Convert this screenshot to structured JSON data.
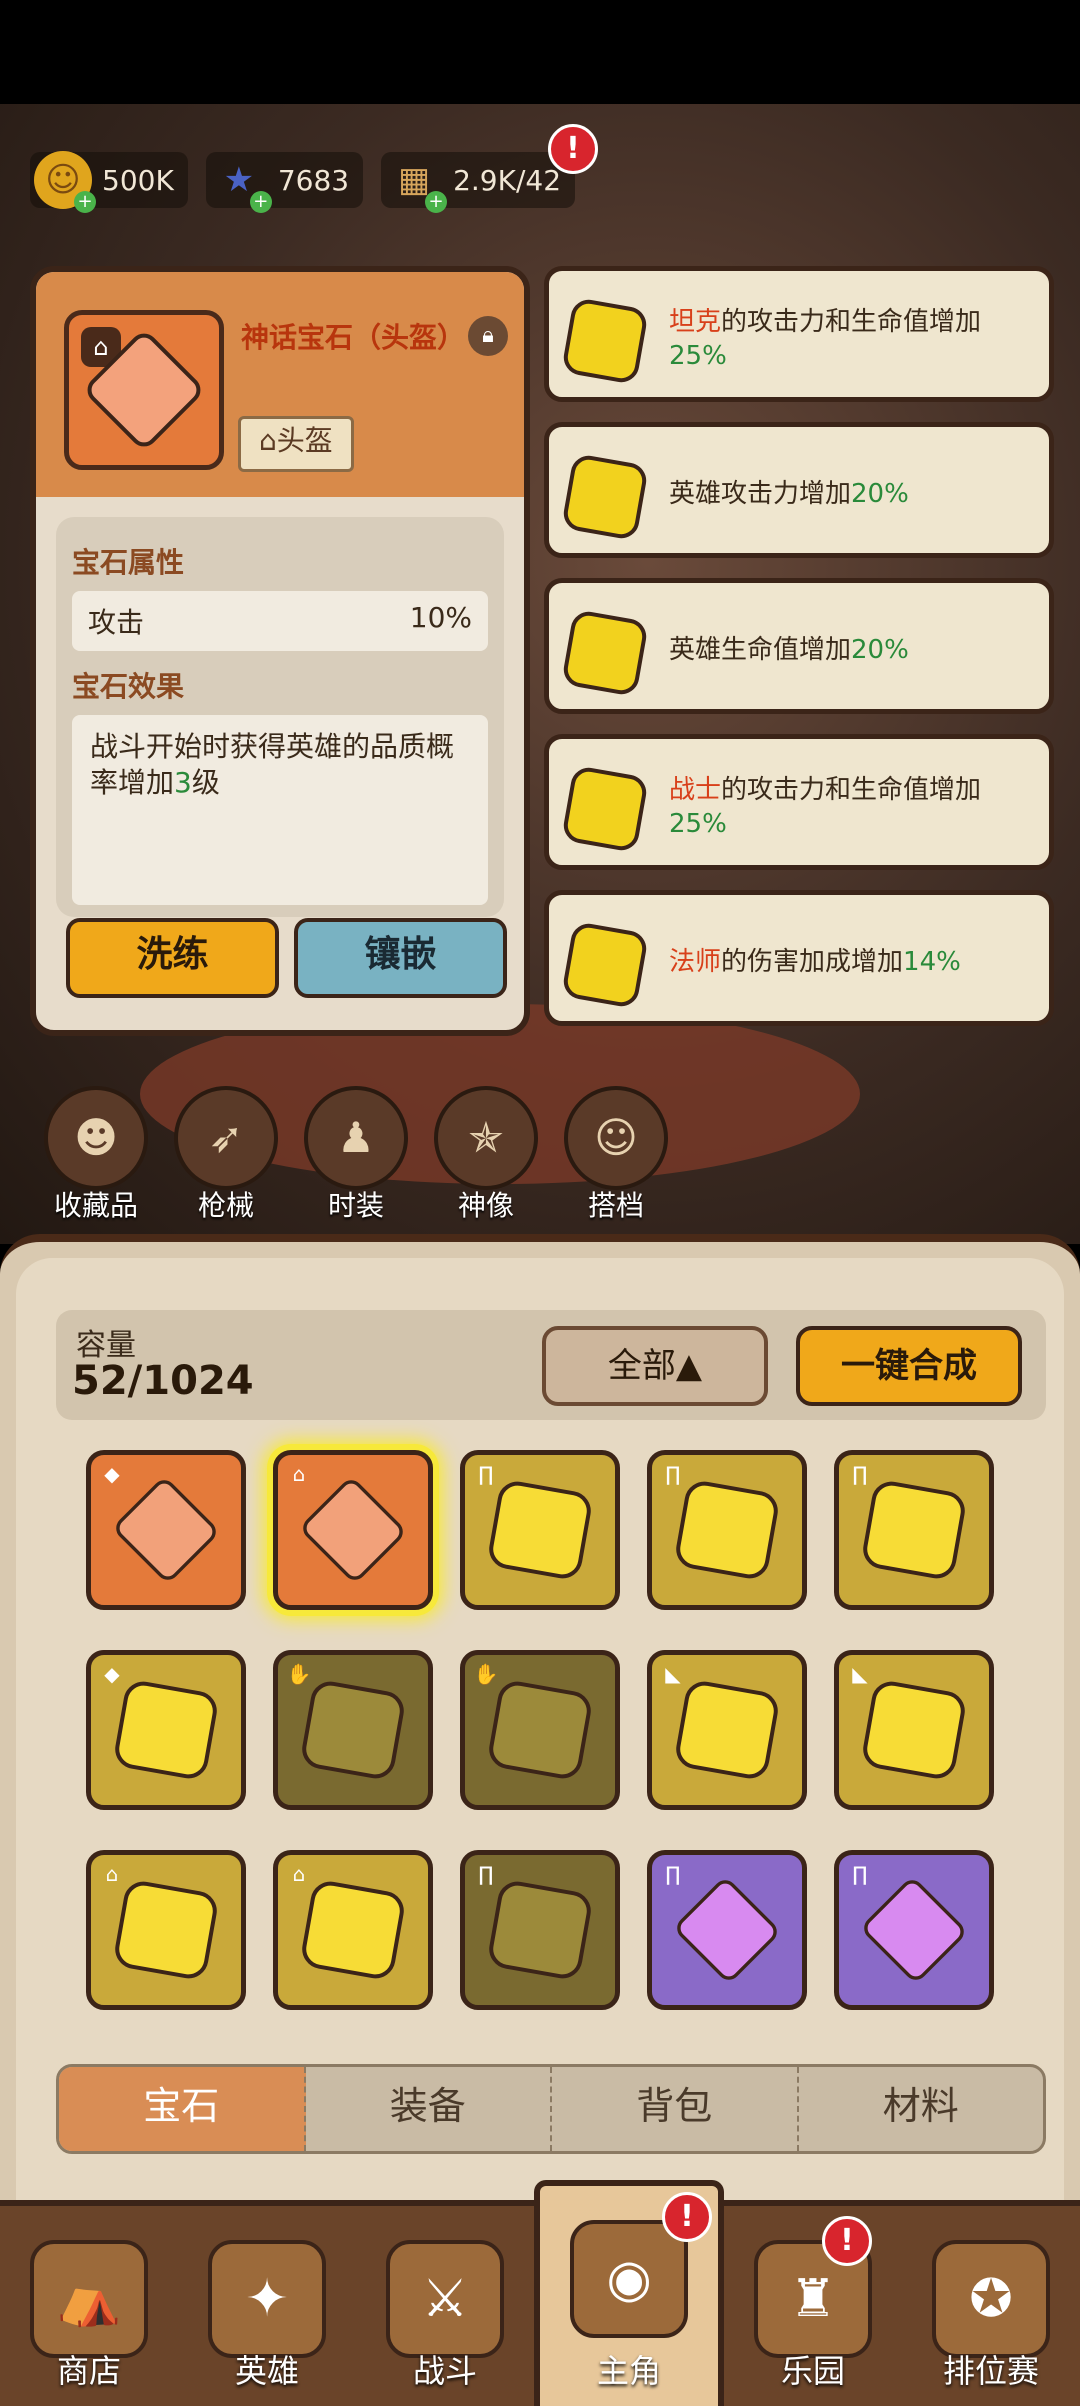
{
  "resources": [
    {
      "icon": "gold-coin-icon",
      "glyph": "☺",
      "value": "500K"
    },
    {
      "icon": "star-gem-icon",
      "glyph": "★",
      "value": "7683"
    },
    {
      "icon": "biscuit-icon",
      "glyph": "▦",
      "value": "2.9K/42"
    }
  ],
  "detail": {
    "title": "神话宝石（头盔）",
    "tag": "头盔",
    "attributes_title": "宝石属性",
    "attribute": {
      "name": "攻击",
      "value": "10%"
    },
    "effect_title": "宝石效果",
    "effect_text_1": "战斗开始时获得英雄的品质概率增加",
    "effect_num": "3",
    "effect_text_2": "级",
    "btn_reroll": "洗练",
    "btn_inlay": "镶嵌"
  },
  "effects": [
    {
      "hl": "坦克",
      "text": "的攻击力和生命值增加",
      "num": "25%"
    },
    {
      "hl": "",
      "text": "英雄攻击力增加",
      "num": "20%"
    },
    {
      "hl": "",
      "text": "英雄生命值增加",
      "num": "20%"
    },
    {
      "hl": "战士",
      "text": "的攻击力和生命值增加",
      "num": "25%"
    },
    {
      "hl": "法师",
      "text": "的伤害加成增加",
      "num": "14%"
    }
  ],
  "categories": [
    "收藏品",
    "枪械",
    "时装",
    "神像",
    "搭档"
  ],
  "inventory": {
    "capacity_label": "容量",
    "capacity": "52/1024",
    "filter": "全部▲",
    "merge": "一键合成",
    "cells": [
      "orange",
      "orange",
      "yellow",
      "yellow",
      "yellow",
      "yellow",
      "dim",
      "dim",
      "yellow",
      "yellow",
      "yellow",
      "yellow",
      "dim",
      "purple",
      "purple"
    ],
    "tabs": [
      "宝石",
      "装备",
      "背包",
      "材料"
    ]
  },
  "nav": [
    {
      "label": "商店",
      "icon": "shop-icon",
      "glyph": "⛺"
    },
    {
      "label": "英雄",
      "icon": "hero-cards-icon",
      "glyph": "✦"
    },
    {
      "label": "战斗",
      "icon": "battle-icon",
      "glyph": "⚔"
    },
    {
      "label": "主角",
      "icon": "owl-icon",
      "glyph": "◉"
    },
    {
      "label": "乐园",
      "icon": "castle-icon",
      "glyph": "♜"
    },
    {
      "label": "排位赛",
      "icon": "rank-badge-icon",
      "glyph": "✪"
    }
  ]
}
